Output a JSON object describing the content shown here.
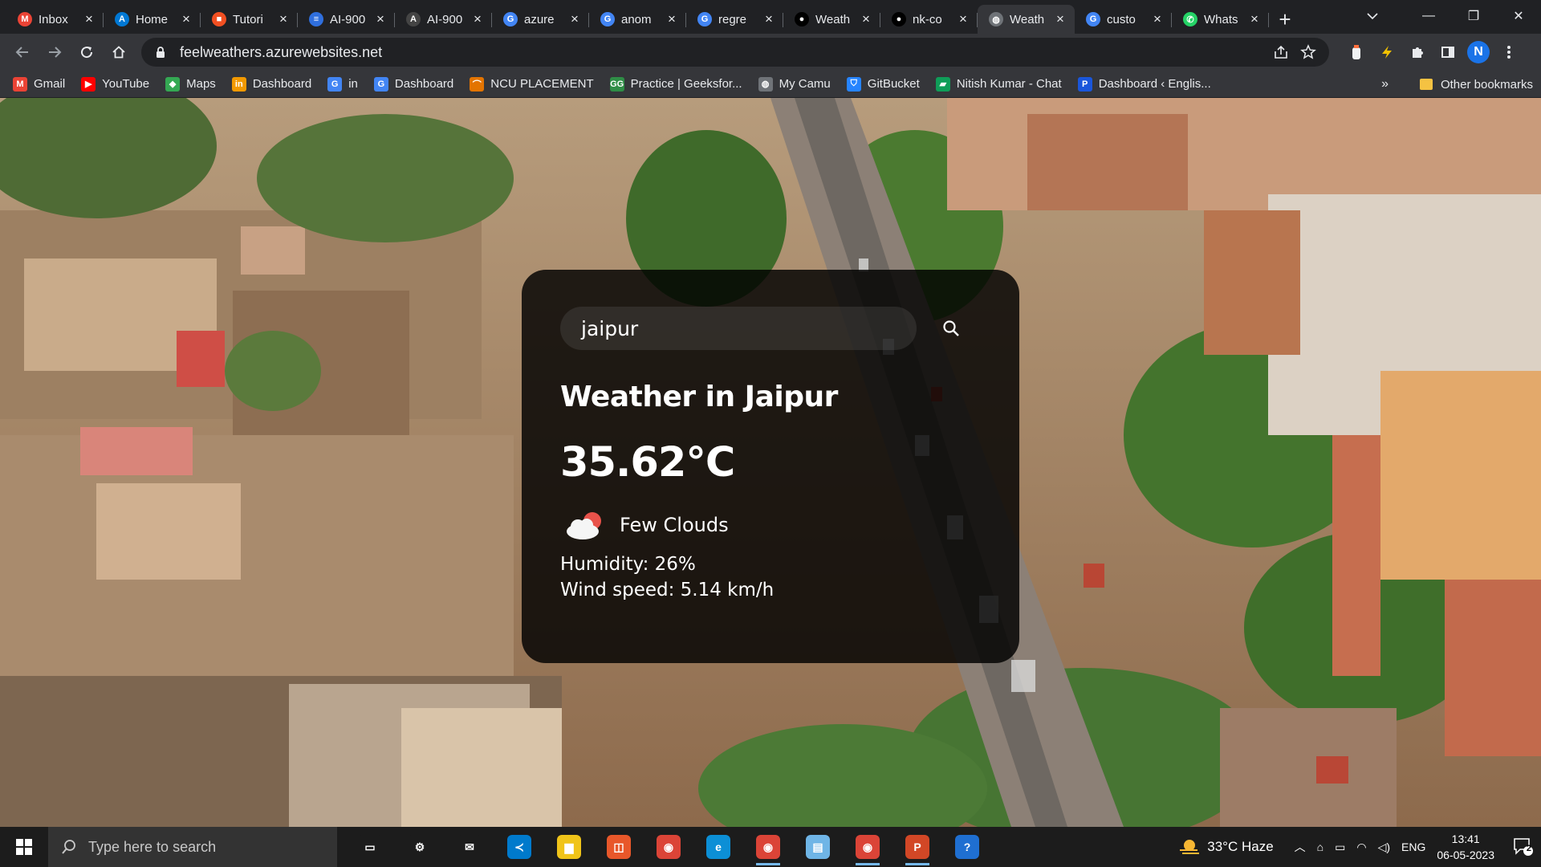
{
  "browser": {
    "tabs": [
      {
        "title": "Inbox",
        "icon": "gmail-icon",
        "color": "#ea4335",
        "glyph": "M"
      },
      {
        "title": "Home",
        "icon": "azure-icon",
        "color": "#0078d4",
        "glyph": "A"
      },
      {
        "title": "Tutori",
        "icon": "microsoft-icon",
        "color": "#f25022",
        "glyph": "■"
      },
      {
        "title": "AI-900",
        "icon": "ai-900-icon",
        "color": "#2f6fde",
        "glyph": "≡"
      },
      {
        "title": "AI-900",
        "icon": "ai-900-icon",
        "color": "#444444",
        "glyph": "A"
      },
      {
        "title": "azure",
        "icon": "google-icon",
        "color": "#4285f4",
        "glyph": "G"
      },
      {
        "title": "anom",
        "icon": "google-icon",
        "color": "#4285f4",
        "glyph": "G"
      },
      {
        "title": "regre",
        "icon": "google-icon",
        "color": "#4285f4",
        "glyph": "G"
      },
      {
        "title": "Weath",
        "icon": "github-icon",
        "color": "#000000",
        "glyph": "●"
      },
      {
        "title": "nk-co",
        "icon": "github-icon",
        "color": "#000000",
        "glyph": "●"
      },
      {
        "title": "Weath",
        "icon": "globe-icon",
        "color": "#6f7378",
        "glyph": "◍",
        "active": true
      },
      {
        "title": "custo",
        "icon": "google-icon",
        "color": "#4285f4",
        "glyph": "G"
      },
      {
        "title": "Whats",
        "icon": "whatsapp-icon",
        "color": "#25d366",
        "glyph": "✆"
      }
    ],
    "url": "feelweathers.azurewebsites.net",
    "profile_initial": "N",
    "bookmarks": [
      {
        "label": "Gmail",
        "icon": "gmail-icon",
        "color": "#ea4335",
        "glyph": "M"
      },
      {
        "label": "YouTube",
        "icon": "youtube-icon",
        "color": "#ff0000",
        "glyph": "▶"
      },
      {
        "label": "Maps",
        "icon": "maps-icon",
        "color": "#34a853",
        "glyph": "◆"
      },
      {
        "label": "Dashboard",
        "icon": "dashboard-icon",
        "color": "#f29900",
        "glyph": "in"
      },
      {
        "label": "in",
        "icon": "google-icon",
        "color": "#4285f4",
        "glyph": "G"
      },
      {
        "label": "Dashboard",
        "icon": "google-icon",
        "color": "#4285f4",
        "glyph": "G"
      },
      {
        "label": "NCU PLACEMENT",
        "icon": "ncu-icon",
        "color": "#e37400",
        "glyph": "⌒"
      },
      {
        "label": "Practice | Geeksfor...",
        "icon": "geeksforgeeks-icon",
        "color": "#2f8d46",
        "glyph": "GG"
      },
      {
        "label": "My Camu",
        "icon": "globe-icon",
        "color": "#6f7378",
        "glyph": "◍"
      },
      {
        "label": "GitBucket",
        "icon": "gitbucket-icon",
        "color": "#2684ff",
        "glyph": "⛉"
      },
      {
        "label": "Nitish Kumar - Chat",
        "icon": "chat-icon",
        "color": "#0f9d58",
        "glyph": "▰"
      },
      {
        "label": "Dashboard ‹ Englis...",
        "icon": "dashboard-p-icon",
        "color": "#1a56db",
        "glyph": "P"
      }
    ],
    "other_bookmarks": "Other bookmarks",
    "more_bookmarks": "»"
  },
  "weather": {
    "search_value": "jaipur",
    "city_heading": "Weather in Jaipur",
    "temperature": "35.62°C",
    "description": "Few Clouds",
    "icon": "few-clouds-icon",
    "humidity": "Humidity: 26%",
    "wind": "Wind speed: 5.14 km/h"
  },
  "taskbar": {
    "search_placeholder": "Type here to search",
    "apps": [
      {
        "name": "task-view-icon",
        "glyph": "▭",
        "color": "#1c1c1c"
      },
      {
        "name": "settings-icon",
        "glyph": "⚙",
        "color": "#1c1c1c"
      },
      {
        "name": "mail-icon",
        "glyph": "✉",
        "color": "#1c1c1c"
      },
      {
        "name": "vscode-icon",
        "glyph": "≺",
        "color": "#007acc"
      },
      {
        "name": "file-explorer-icon",
        "glyph": "▆",
        "color": "#f0c419"
      },
      {
        "name": "office-icon",
        "glyph": "◫",
        "color": "#e8572a"
      },
      {
        "name": "chrome-icon",
        "glyph": "◉",
        "color": "#db4437"
      },
      {
        "name": "edge-icon",
        "glyph": "e",
        "color": "#0c8fd6"
      },
      {
        "name": "chrome-profile-icon",
        "glyph": "◉",
        "color": "#db4437",
        "running": true
      },
      {
        "name": "notepad-icon",
        "glyph": "▤",
        "color": "#6fb5e6"
      },
      {
        "name": "chrome-icon",
        "glyph": "◉",
        "color": "#db4437",
        "running": true
      },
      {
        "name": "powerpoint-icon",
        "glyph": "P",
        "color": "#d24726",
        "running": true
      },
      {
        "name": "help-icon",
        "glyph": "?",
        "color": "#1f6fd1"
      }
    ],
    "weather_widget": "33°C  Haze",
    "language": "ENG",
    "time": "13:41",
    "date": "06-05-2023",
    "notification_count": "2"
  }
}
